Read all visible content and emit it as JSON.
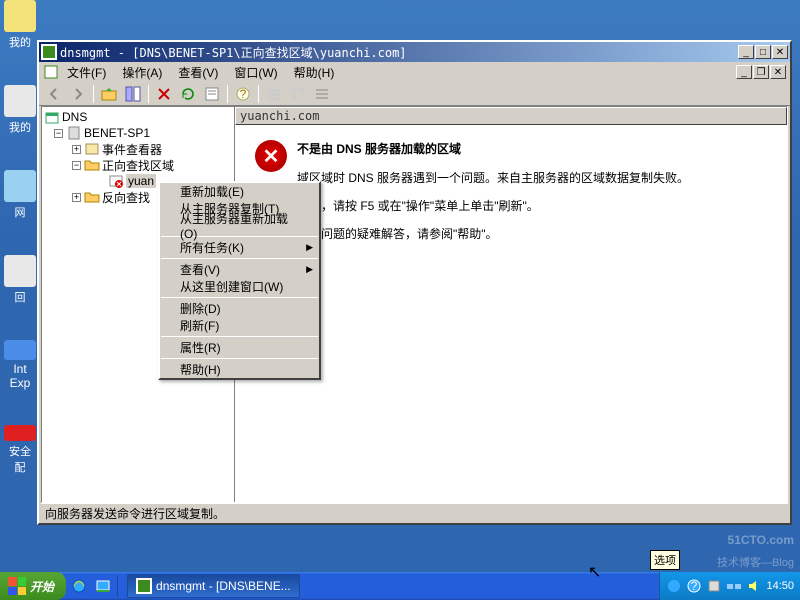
{
  "desktop": {
    "icons": [
      {
        "label": "我的"
      },
      {
        "label": "我的"
      },
      {
        "label": "网"
      },
      {
        "label": "回"
      },
      {
        "label_line1": "Int",
        "label_line2": "Exp"
      },
      {
        "label": "安全配"
      }
    ]
  },
  "window": {
    "title": "dnsmgmt - [DNS\\BENET-SP1\\正向查找区域\\yuanchi.com]",
    "menus": {
      "file": "文件(F)",
      "action": "操作(A)",
      "view": "查看(V)",
      "window": "窗口(W)",
      "help": "帮助(H)"
    },
    "tree": {
      "root": "DNS",
      "server": "BENET-SP1",
      "event_viewer": "事件查看器",
      "forward_zone": "正向查找区域",
      "zone_name": "yuan",
      "reverse_zone": "反向查找"
    },
    "right": {
      "header": "yuanchi.com",
      "error_title": "不是由 DNS 服务器加载的区域",
      "p1": "域区域时 DNS 服务器遇到一个问题。来自主服务器的区域数据复制失败。",
      "p2": "问题，请按 F5 或在\"操作\"菜单上单击\"刷新\"。",
      "p3": "区域问题的疑难解答，请参阅\"帮助\"。"
    },
    "status": "向服务器发送命令进行区域复制。"
  },
  "context_menu": {
    "reload": "重新加载(E)",
    "copy_from_master": "从主服务器复制(T)",
    "reload_from_master": "从主服务器重新加载(O)",
    "all_tasks": "所有任务(K)",
    "view": "查看(V)",
    "new_window": "从这里创建窗口(W)",
    "delete": "删除(D)",
    "refresh": "刷新(F)",
    "properties": "属性(R)",
    "help": "帮助(H)"
  },
  "taskbar": {
    "start": "开始",
    "task1": "dnsmgmt - [DNS\\BENE...",
    "tooltip": "选项",
    "clock": "14:50"
  },
  "watermark": {
    "main": "51CTO.com",
    "sub": "技术博客—Blog"
  }
}
